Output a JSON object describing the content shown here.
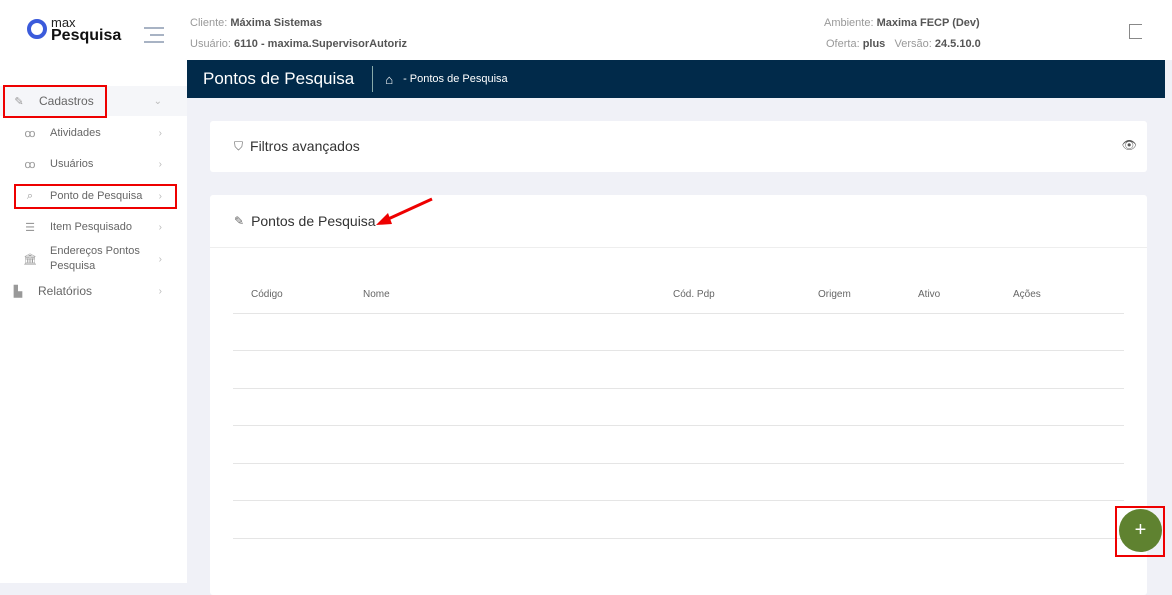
{
  "logo": {
    "line1": "max",
    "line2": "Pesquisa"
  },
  "header": {
    "cliente_label": "Cliente:",
    "cliente": "Máxima Sistemas",
    "usuario_label": "Usuário:",
    "usuario": "6110 - maxima.SupervisorAutoriz",
    "ambiente_label": "Ambiente:",
    "ambiente": "Maxima FECP (Dev)",
    "oferta_label": "Oferta:",
    "oferta": "plus",
    "versao_label": "Versão:",
    "versao": "24.5.10.0"
  },
  "sidebar": {
    "items": [
      {
        "label": "Cadastros"
      },
      {
        "label": "Atividades"
      },
      {
        "label": "Usuários"
      },
      {
        "label": "Ponto de Pesquisa"
      },
      {
        "label": "Item Pesquisado"
      },
      {
        "label": "Endereços Pontos Pesquisa"
      },
      {
        "label": "Relatórios"
      }
    ]
  },
  "page": {
    "title": "Pontos de Pesquisa",
    "breadcrumb": "- Pontos de Pesquisa"
  },
  "filters": {
    "title": "Filtros avançados"
  },
  "list": {
    "title": "Pontos de Pesquisa",
    "columns": [
      "Código",
      "Nome",
      "Cód. Pdp",
      "Origem",
      "Ativo",
      "Ações"
    ]
  },
  "fab": {
    "label": "+"
  },
  "colors": {
    "band": "#012a4a",
    "fab": "#5f8230",
    "highlight": "#ee0000"
  }
}
